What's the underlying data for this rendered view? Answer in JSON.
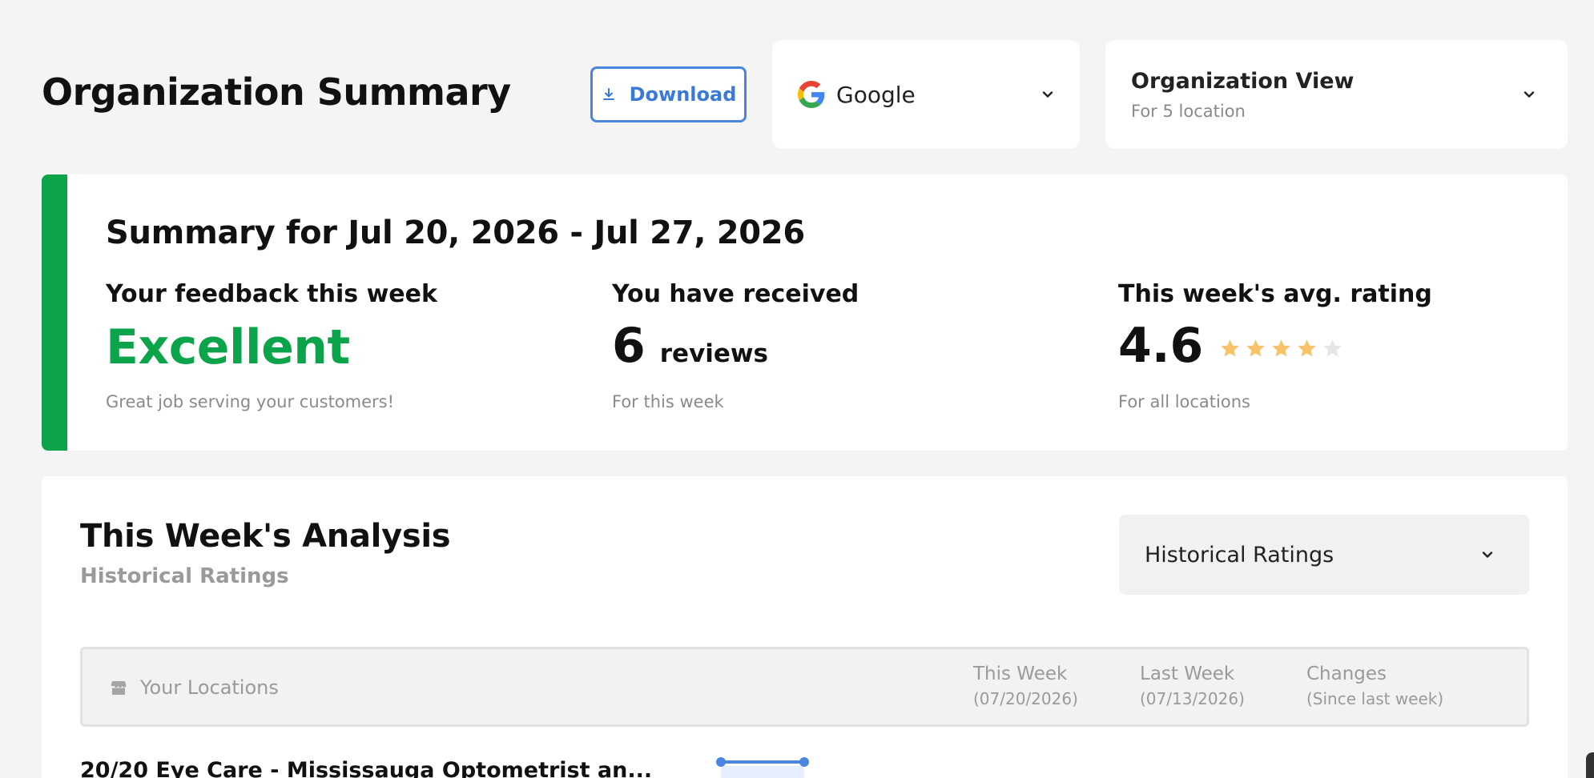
{
  "header": {
    "title": "Organization Summary",
    "download_label": "Download",
    "platform_select": {
      "value": "Google"
    },
    "view_select": {
      "title": "Organization View",
      "subtitle": "For 5 location"
    }
  },
  "summary": {
    "heading": "Summary for Jul 20, 2026 - Jul 27, 2026",
    "feedback": {
      "label": "Your feedback this week",
      "value": "Excellent",
      "note": "Great job serving your customers!"
    },
    "received": {
      "label": "You have received",
      "count": "6",
      "unit": "reviews",
      "note": "For this week"
    },
    "rating": {
      "label": "This week's avg. rating",
      "value": "4.6",
      "stars_filled": 4,
      "stars_total": 5,
      "note": "For all locations"
    }
  },
  "analysis": {
    "title": "This Week's Analysis",
    "subtitle": "Historical Ratings",
    "view_select": "Historical Ratings",
    "table": {
      "location_header": "Your Locations",
      "columns": [
        {
          "title": "This Week",
          "sub": "(07/20/2026)"
        },
        {
          "title": "Last Week",
          "sub": "(07/13/2026)"
        },
        {
          "title": "Changes",
          "sub": "(Since last week)"
        }
      ],
      "rows": [
        {
          "name": "20/20 Eye Care - Mississauga Optometrist an..."
        }
      ]
    }
  },
  "colors": {
    "accent_green": "#0ca44b",
    "accent_blue": "#3a79d8",
    "star_gold": "#f7c46c",
    "star_empty": "#e6e6e6"
  }
}
